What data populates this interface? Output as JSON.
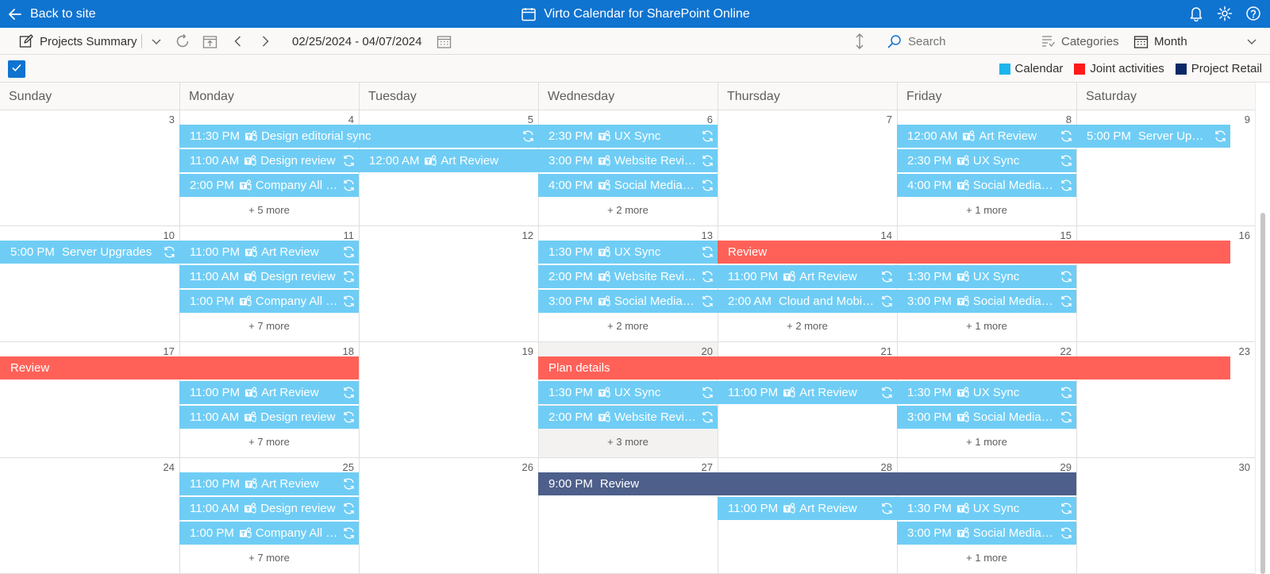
{
  "topbar": {
    "back_label": "Back to site",
    "app_title": "Virto Calendar for SharePoint Online",
    "bg_color": "#0f73d0"
  },
  "toolbar": {
    "view_name": "Projects Summary",
    "date_range": "02/25/2024 - 04/07/2024",
    "search_placeholder": "Search",
    "categories_label": "Categories",
    "view_mode": "Month"
  },
  "legend": [
    {
      "label": "Calendar",
      "color": "#1cb4ec"
    },
    {
      "label": "Joint activities",
      "color": "#ff1a1a"
    },
    {
      "label": "Project Retail",
      "color": "#0b2866"
    }
  ],
  "day_names": [
    "Sunday",
    "Monday",
    "Tuesday",
    "Wednesday",
    "Thursday",
    "Friday",
    "Saturday"
  ],
  "weeks": [
    {
      "days": [
        "3",
        "4",
        "5",
        "6",
        "7",
        "8",
        "9"
      ],
      "more": [
        null,
        "+ 5 more",
        null,
        "+ 2 more",
        null,
        "+ 1 more",
        null
      ]
    },
    {
      "days": [
        "10",
        "11",
        "12",
        "13",
        "14",
        "15",
        "16"
      ],
      "more": [
        null,
        "+ 7 more",
        null,
        "+ 2 more",
        "+ 2 more",
        "+ 1 more",
        null
      ]
    },
    {
      "days": [
        "17",
        "18",
        "19",
        "20",
        "21",
        "22",
        "23"
      ],
      "more": [
        null,
        "+ 7 more",
        null,
        "+ 3 more",
        null,
        "+ 1 more",
        null
      ]
    },
    {
      "days": [
        "24",
        "25",
        "26",
        "27",
        "28",
        "29",
        "30"
      ],
      "more": [
        null,
        "+ 7 more",
        null,
        null,
        null,
        "+ 1 more",
        null
      ]
    }
  ],
  "today": {
    "week": 2,
    "col": 3
  },
  "events": [
    {
      "week": 0,
      "col": 1,
      "span": 2,
      "row": 0,
      "cat": "cal",
      "time": "11:30 PM",
      "title": "Design editorial sync",
      "teams": true,
      "recurring": true
    },
    {
      "week": 0,
      "col": 1,
      "span": 1,
      "row": 1,
      "cat": "cal",
      "time": "11:00 AM",
      "title": "Design review",
      "teams": true,
      "recurring": true
    },
    {
      "week": 0,
      "col": 1,
      "span": 1,
      "row": 2,
      "cat": "cal",
      "time": "2:00 PM",
      "title": "Company All Hands",
      "teams": true,
      "recurring": true
    },
    {
      "week": 0,
      "col": 2,
      "span": 1,
      "row": 1,
      "cat": "cal",
      "time": "12:00 AM",
      "title": "Art Review",
      "teams": true,
      "recurring": false
    },
    {
      "week": 0,
      "col": 3,
      "span": 1,
      "row": 0,
      "cat": "cal",
      "time": "2:30 PM",
      "title": "UX Sync",
      "teams": true,
      "recurring": true
    },
    {
      "week": 0,
      "col": 3,
      "span": 1,
      "row": 1,
      "cat": "cal",
      "time": "3:00 PM",
      "title": "Website Review",
      "teams": true,
      "recurring": true
    },
    {
      "week": 0,
      "col": 3,
      "span": 1,
      "row": 2,
      "cat": "cal",
      "time": "4:00 PM",
      "title": "Social Media Strategy",
      "teams": true,
      "recurring": true
    },
    {
      "week": 0,
      "col": 5,
      "span": 1,
      "row": 0,
      "cat": "cal",
      "time": "12:00 AM",
      "title": "Art Review",
      "teams": true,
      "recurring": true
    },
    {
      "week": 0,
      "col": 5,
      "span": 1,
      "row": 1,
      "cat": "cal",
      "time": "2:30 PM",
      "title": "UX Sync",
      "teams": true,
      "recurring": true
    },
    {
      "week": 0,
      "col": 5,
      "span": 1,
      "row": 2,
      "cat": "cal",
      "time": "4:00 PM",
      "title": "Social Media Strategy",
      "teams": true,
      "recurring": true
    },
    {
      "week": 0,
      "col": 6,
      "span": 1,
      "row": 0,
      "cat": "cal",
      "time": "5:00 PM",
      "title": "Server Upgrades",
      "teams": false,
      "recurring": true
    },
    {
      "week": 1,
      "col": 0,
      "span": 1,
      "row": 0,
      "cat": "cal",
      "time": "5:00 PM",
      "title": "Server Upgrades",
      "teams": false,
      "recurring": true
    },
    {
      "week": 1,
      "col": 1,
      "span": 1,
      "row": 0,
      "cat": "cal",
      "time": "11:00 PM",
      "title": "Art Review",
      "teams": true,
      "recurring": true
    },
    {
      "week": 1,
      "col": 1,
      "span": 1,
      "row": 1,
      "cat": "cal",
      "time": "11:00 AM",
      "title": "Design review",
      "teams": true,
      "recurring": true
    },
    {
      "week": 1,
      "col": 1,
      "span": 1,
      "row": 2,
      "cat": "cal",
      "time": "1:00 PM",
      "title": "Company All Hands",
      "teams": true,
      "recurring": true
    },
    {
      "week": 1,
      "col": 3,
      "span": 1,
      "row": 0,
      "cat": "cal",
      "time": "1:30 PM",
      "title": "UX Sync",
      "teams": true,
      "recurring": true
    },
    {
      "week": 1,
      "col": 3,
      "span": 1,
      "row": 1,
      "cat": "cal",
      "time": "2:00 PM",
      "title": "Website Review",
      "teams": true,
      "recurring": true
    },
    {
      "week": 1,
      "col": 3,
      "span": 1,
      "row": 2,
      "cat": "cal",
      "time": "3:00 PM",
      "title": "Social Media Strategy",
      "teams": true,
      "recurring": true
    },
    {
      "week": 1,
      "col": 4,
      "span": 3,
      "row": 0,
      "cat": "joint",
      "time": "",
      "title": "Review",
      "teams": false,
      "recurring": false
    },
    {
      "week": 1,
      "col": 4,
      "span": 1,
      "row": 1,
      "cat": "cal",
      "time": "11:00 PM",
      "title": "Art Review",
      "teams": true,
      "recurring": true
    },
    {
      "week": 1,
      "col": 4,
      "span": 1,
      "row": 2,
      "cat": "cal",
      "time": "2:00 AM",
      "title": "Cloud and Mobile Strategy",
      "teams": false,
      "recurring": true
    },
    {
      "week": 1,
      "col": 5,
      "span": 1,
      "row": 1,
      "cat": "cal",
      "time": "1:30 PM",
      "title": "UX Sync",
      "teams": true,
      "recurring": true
    },
    {
      "week": 1,
      "col": 5,
      "span": 1,
      "row": 2,
      "cat": "cal",
      "time": "3:00 PM",
      "title": "Social Media Strategy",
      "teams": true,
      "recurring": true
    },
    {
      "week": 2,
      "col": 0,
      "span": 2,
      "row": 0,
      "cat": "joint",
      "time": "",
      "title": "Review",
      "teams": false,
      "recurring": false
    },
    {
      "week": 2,
      "col": 1,
      "span": 1,
      "row": 1,
      "cat": "cal",
      "time": "11:00 PM",
      "title": "Art Review",
      "teams": true,
      "recurring": true
    },
    {
      "week": 2,
      "col": 1,
      "span": 1,
      "row": 2,
      "cat": "cal",
      "time": "11:00 AM",
      "title": "Design review",
      "teams": true,
      "recurring": true
    },
    {
      "week": 2,
      "col": 3,
      "span": 4,
      "row": 0,
      "cat": "joint",
      "time": "",
      "title": "Plan details",
      "teams": false,
      "recurring": false
    },
    {
      "week": 2,
      "col": 3,
      "span": 1,
      "row": 1,
      "cat": "cal",
      "time": "1:30 PM",
      "title": "UX Sync",
      "teams": true,
      "recurring": true
    },
    {
      "week": 2,
      "col": 3,
      "span": 1,
      "row": 2,
      "cat": "cal",
      "time": "2:00 PM",
      "title": "Website Review",
      "teams": true,
      "recurring": true
    },
    {
      "week": 2,
      "col": 4,
      "span": 1,
      "row": 1,
      "cat": "cal",
      "time": "11:00 PM",
      "title": "Art Review",
      "teams": true,
      "recurring": true
    },
    {
      "week": 2,
      "col": 5,
      "span": 1,
      "row": 1,
      "cat": "cal",
      "time": "1:30 PM",
      "title": "UX Sync",
      "teams": true,
      "recurring": true
    },
    {
      "week": 2,
      "col": 5,
      "span": 1,
      "row": 2,
      "cat": "cal",
      "time": "3:00 PM",
      "title": "Social Media Strategy",
      "teams": true,
      "recurring": true
    },
    {
      "week": 3,
      "col": 1,
      "span": 1,
      "row": 0,
      "cat": "cal",
      "time": "11:00 PM",
      "title": "Art Review",
      "teams": true,
      "recurring": true
    },
    {
      "week": 3,
      "col": 1,
      "span": 1,
      "row": 1,
      "cat": "cal",
      "time": "11:00 AM",
      "title": "Design review",
      "teams": true,
      "recurring": true
    },
    {
      "week": 3,
      "col": 1,
      "span": 1,
      "row": 2,
      "cat": "cal",
      "time": "1:00 PM",
      "title": "Company All Hands",
      "teams": true,
      "recurring": true
    },
    {
      "week": 3,
      "col": 3,
      "span": 3,
      "row": 0,
      "cat": "retail",
      "time": "9:00 PM",
      "title": "Review",
      "teams": false,
      "recurring": false
    },
    {
      "week": 3,
      "col": 4,
      "span": 1,
      "row": 1,
      "cat": "cal",
      "time": "11:00 PM",
      "title": "Art Review",
      "teams": true,
      "recurring": true
    },
    {
      "week": 3,
      "col": 5,
      "span": 1,
      "row": 1,
      "cat": "cal",
      "time": "1:30 PM",
      "title": "UX Sync",
      "teams": true,
      "recurring": true
    },
    {
      "week": 3,
      "col": 5,
      "span": 1,
      "row": 2,
      "cat": "cal",
      "time": "3:00 PM",
      "title": "Social Media Strategy",
      "teams": true,
      "recurring": true
    }
  ]
}
